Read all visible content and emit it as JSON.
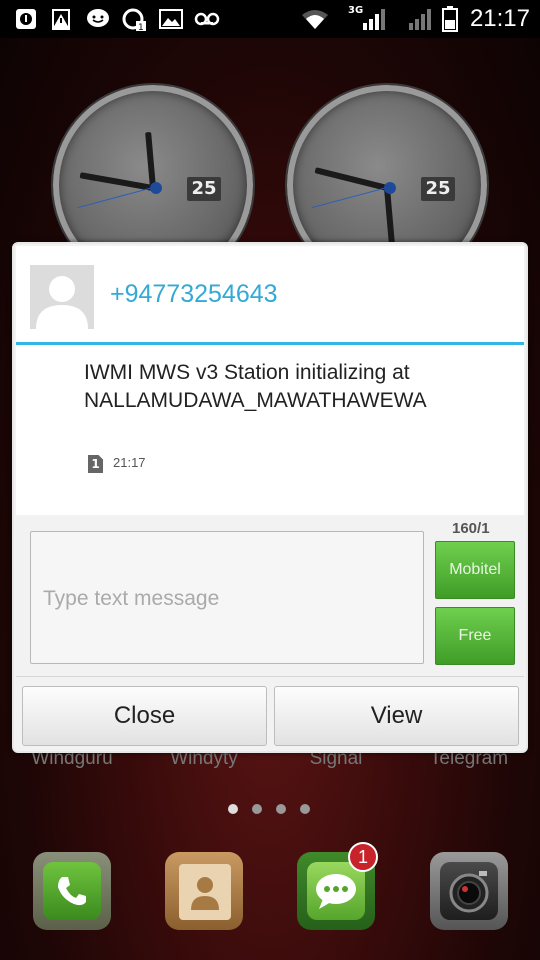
{
  "status_bar": {
    "time": "21:17",
    "network_type": "3G",
    "icons": [
      "sim-alert-icon",
      "warning-icon",
      "emoji-icon",
      "sync-icon",
      "image-icon",
      "voicemail-icon",
      "wifi-icon",
      "signal-icon",
      "signal-icon-2",
      "battery-icon"
    ]
  },
  "wallpaper": {
    "clocks": [
      {
        "date": "25"
      },
      {
        "date": "25"
      }
    ],
    "home_labels": [
      "Windguru",
      "Windyty",
      "Signal",
      "Telegram"
    ],
    "page_count": 4,
    "active_page": 1,
    "dock": [
      {
        "icon": "phone-icon"
      },
      {
        "icon": "contacts-icon"
      },
      {
        "icon": "messaging-icon",
        "badge": "1"
      },
      {
        "icon": "camera-icon"
      }
    ]
  },
  "dialog": {
    "sender": "+94773254643",
    "message": "IWMI MWS v3 Station initializing at NALLAMUDAWA_MAWATHAWEWA",
    "sim_slot": "1",
    "time": "21:17",
    "compose_placeholder": "Type text message",
    "char_counter": "160/1",
    "send_buttons": [
      "Mobitel",
      "Free"
    ],
    "close_label": "Close",
    "view_label": "View"
  },
  "colors": {
    "accent": "#33b5e5",
    "sender_text": "#33a9d6",
    "send_button": "#55b83a",
    "badge": "#c8222a"
  }
}
